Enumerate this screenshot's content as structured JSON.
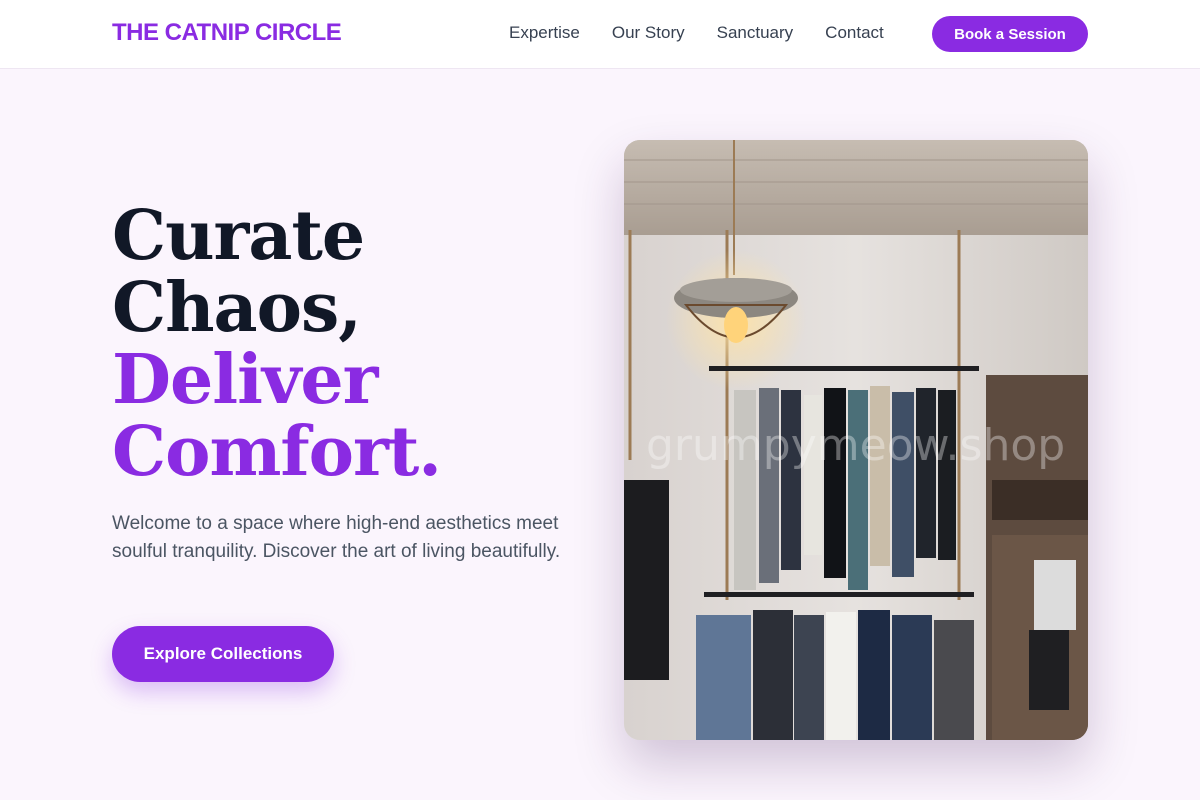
{
  "header": {
    "logo": "THE CATNIP CIRCLE",
    "nav": [
      "Expertise",
      "Our Story",
      "Sanctuary",
      "Contact"
    ],
    "cta": "Book a Session"
  },
  "hero": {
    "title_lines": [
      "Curate",
      "Chaos,"
    ],
    "title_accent_lines": [
      "Deliver",
      "Comfort."
    ],
    "subtitle": "Welcome to a space where high-end aesthetics meet soulful tranquility. Discover the art of living beautifully.",
    "cta": "Explore Collections",
    "image_watermark": "grumpymeow.shop"
  },
  "colors": {
    "accent": "#8a2be2",
    "heading": "#111827",
    "background": "#fbf5fd"
  }
}
